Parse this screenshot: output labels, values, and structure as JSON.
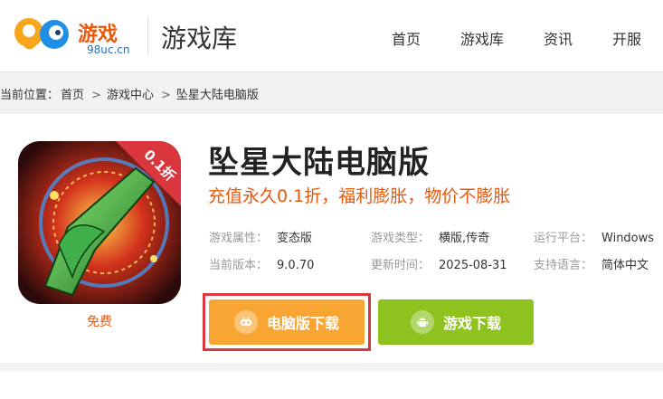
{
  "header": {
    "logo_brand": "游戏",
    "logo_domain": "98uc.cn",
    "section_title": "游戏库",
    "nav": [
      {
        "label": "首页"
      },
      {
        "label": "游戏库"
      },
      {
        "label": "资讯"
      },
      {
        "label": "开服"
      }
    ]
  },
  "breadcrumb": {
    "prefix": "当前位置：",
    "items": [
      "首页",
      "游戏中心",
      "坠星大陆电脑版"
    ],
    "separator": ">"
  },
  "game": {
    "title": "坠星大陆电脑版",
    "subtitle": "充值永久0.1折，福利膨胀，物价不膨胀",
    "price": "免费",
    "discount_badge": "0.1折",
    "info": {
      "attr_label": "游戏属性：",
      "attr_value": "变态版",
      "type_label": "游戏类型：",
      "type_value": "横版,传奇",
      "platform_label": "运行平台：",
      "platform_value": "Windows",
      "version_label": "当前版本：",
      "version_value": "9.0.70",
      "update_label": "更新时间：",
      "update_value": "2025-08-31",
      "lang_label": "支持语言：",
      "lang_value": "简体中文"
    },
    "buttons": {
      "pc_download": "电脑版下载",
      "game_download": "游戏下载"
    }
  },
  "colors": {
    "accent_orange": "#e8590c",
    "pc_button": "#f8a534",
    "game_button": "#8dc21f",
    "highlight_outline": "#d9363e"
  }
}
